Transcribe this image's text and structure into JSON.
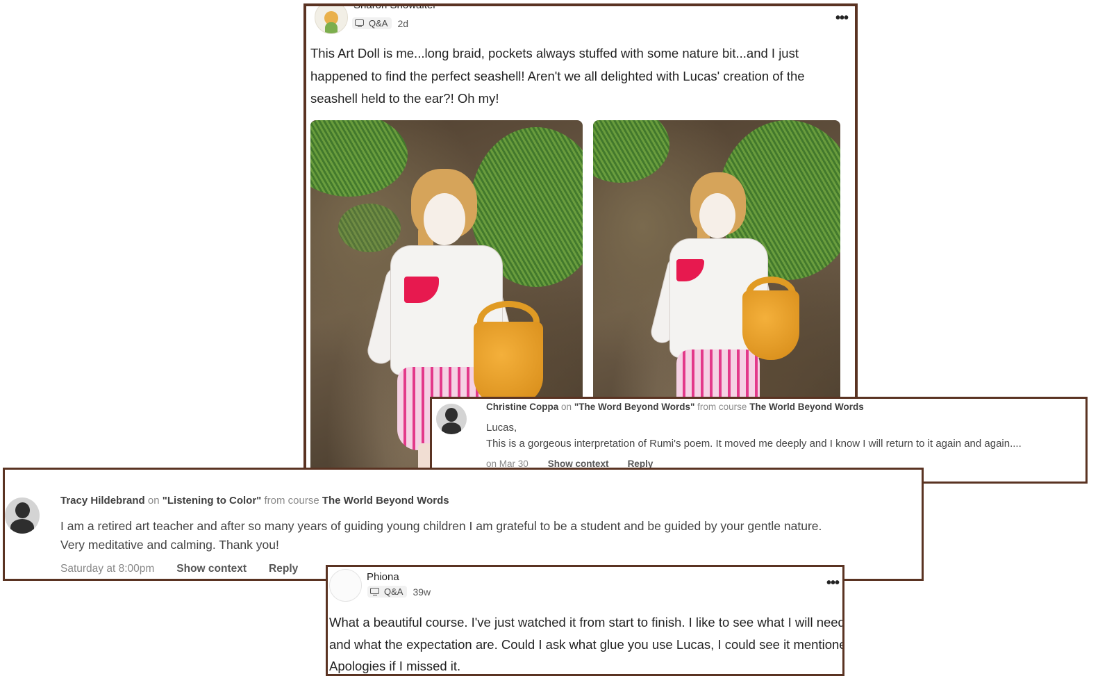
{
  "post1": {
    "author": "Sharon Showalter",
    "tag": "Q&A",
    "time": "2d",
    "more": "•••",
    "body": "This Art Doll is me...long braid, pockets always stuffed with some nature bit...and I just happened to find the perfect seashell! Aren't we all delighted with Lucas' creation of the seashell held to the ear?! Oh my!"
  },
  "comment1": {
    "author": "Christine Coppa",
    "on": "on",
    "lesson": "\"The Word Beyond Words\"",
    "from": "from course",
    "course": "The World Beyond Words",
    "line1": "Lucas,",
    "line2": "This is a gorgeous interpretation of Rumi's poem. It moved me deeply and I know I will return to it again and again....",
    "date": "on Mar 30",
    "show_context": "Show context",
    "reply": "Reply"
  },
  "comment2": {
    "author": "Tracy Hildebrand",
    "on": "on",
    "lesson": "\"Listening to Color\"",
    "from": "from course",
    "course": "The World Beyond Words",
    "line1": "I am a retired art teacher and after so many years of guiding young children I am grateful to be a student and be guided by your gentle nature.",
    "line2": "Very meditative and calming. Thank you!",
    "date": "Saturday at 8:00pm",
    "show_context": "Show context",
    "reply": "Reply"
  },
  "post2": {
    "author": "Phiona",
    "tag": "Q&A",
    "time": "39w",
    "more": "•••",
    "body": "What a beautiful course. I've just watched it from start to finish. I like to see what I will need and what the expectation are. Could I ask what glue you use Lucas, I could see it mentioned. Apologies if I missed it."
  },
  "colors": {
    "frame": "#5a3322",
    "muted": "#8a8a8a"
  }
}
